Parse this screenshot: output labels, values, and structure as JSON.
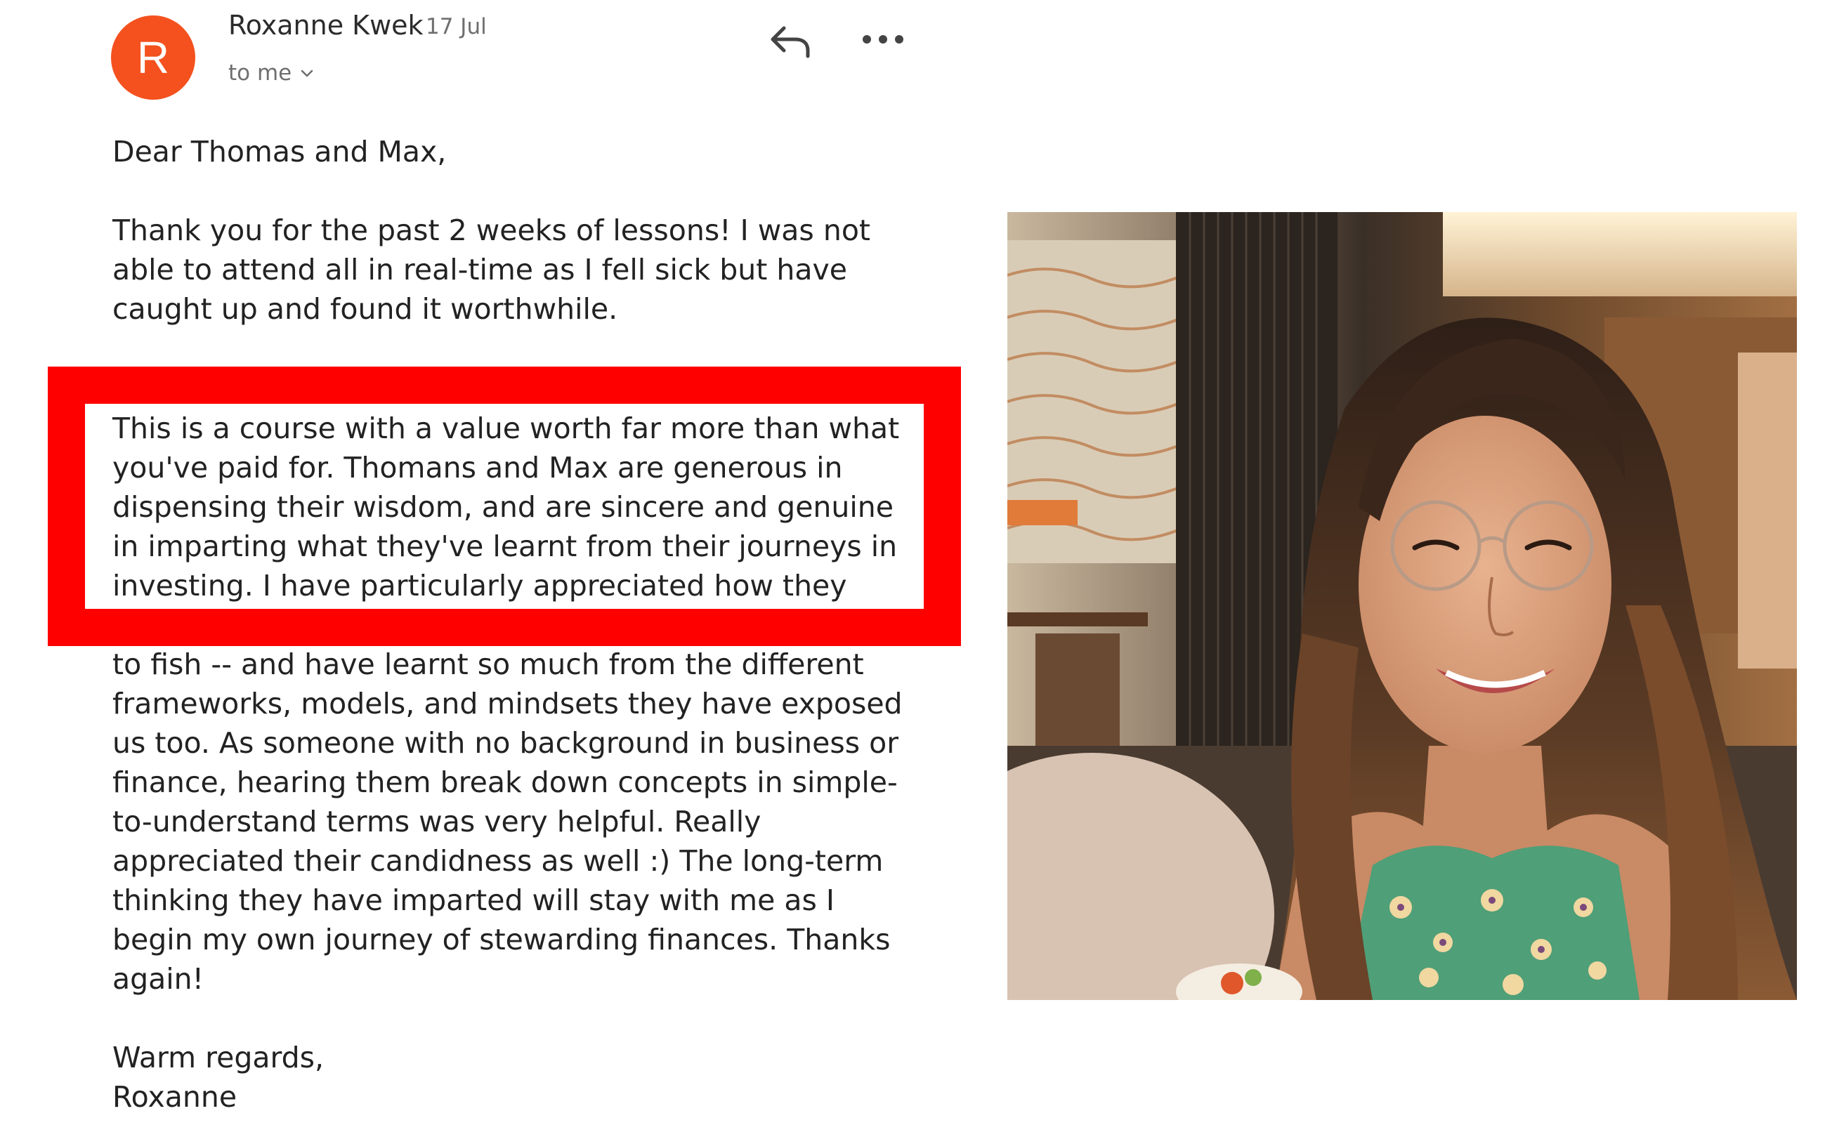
{
  "email": {
    "avatar_initial": "R",
    "sender_name": "Roxanne Kwek",
    "date": "17 Jul",
    "recipient": "to me",
    "icons": {
      "reply": "reply-icon",
      "more": "more-options-icon",
      "expand": "chevron-down-icon"
    },
    "greeting": "Dear Thomas and Max,",
    "paragraph1": [
      "Thank you for the past 2 weeks of lessons! I was not",
      "able to attend all in real-time as I fell sick but have",
      "caught up and found it worthwhile."
    ],
    "highlighted_paragraph": [
      "This is a course with a value worth far more than what",
      "you've paid for. Thomans and Max are generous in",
      "dispensing their wisdom, and are sincere and genuine",
      "in imparting what they've learnt from their journeys in",
      "investing. I have particularly appreciated how they"
    ],
    "paragraph2": [
      "to fish -- and have learnt so much from the different",
      "frameworks, models, and mindsets they have exposed",
      "us too. As someone with no background in business or",
      "finance, hearing them break down concepts in simple-",
      "to-understand terms was very helpful. Really",
      "appreciated their candidness as well :) The long-term",
      "thinking they have imparted will stay with me as I",
      "begin my own journey of stewarding finances. Thanks",
      "again!"
    ],
    "signoff": "Warm regards,",
    "signature": "Roxanne"
  },
  "colors": {
    "avatar": "#f4511e",
    "highlight_border": "#ff0000",
    "text": "#222222",
    "muted": "#6f6f6f"
  }
}
